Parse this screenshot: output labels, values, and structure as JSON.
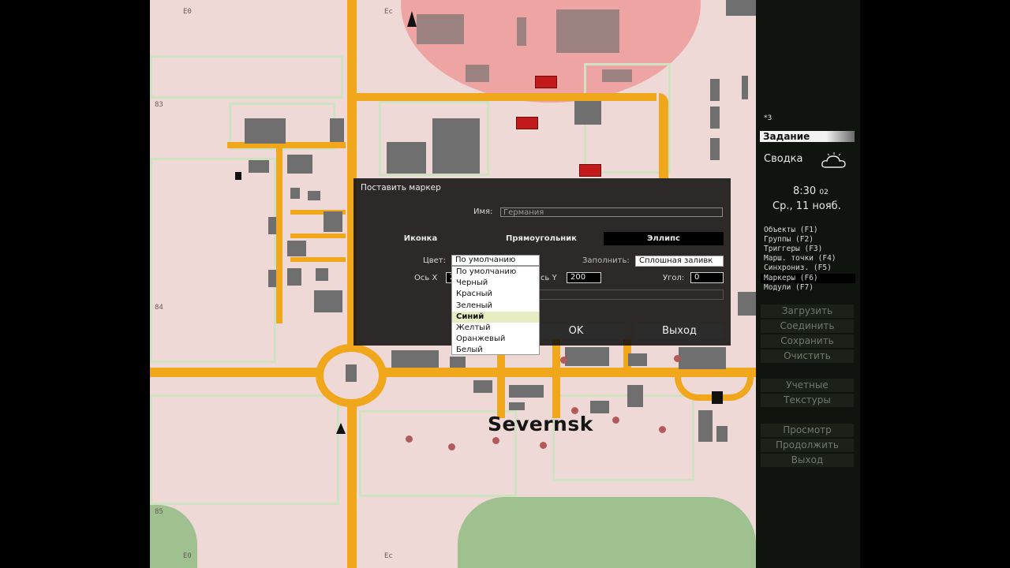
{
  "map": {
    "town": "Severnsk",
    "grid_labels": {
      "top_left": "E0",
      "top_mid": "Ec",
      "row_83": "83",
      "row_84": "84",
      "row_85": "85",
      "bottom_left": "E0",
      "bottom_mid": "Ec"
    },
    "colors": {
      "ground": "#efd9d6",
      "road": "#f0a71c",
      "forest": "#9fc08f",
      "building": "#6f6f6f",
      "danger_zone": "#ec7878"
    }
  },
  "right_panel": {
    "top_marker": "*3",
    "header": "Задание",
    "briefing": "Сводка",
    "weather_icon": "cloud-icon",
    "time": "8:30",
    "time_seconds": "02",
    "date": "Ср., 11 нояб.",
    "menu": [
      {
        "label": "Объекты (F1)",
        "selected": false
      },
      {
        "label": "Группы (F2)",
        "selected": false
      },
      {
        "label": "Триггеры (F3)",
        "selected": false
      },
      {
        "label": "Марш. точки (F4)",
        "selected": false
      },
      {
        "label": "Синхрониз. (F5)",
        "selected": false
      },
      {
        "label": "Маркеры (F6)",
        "selected": true
      },
      {
        "label": "Модули (F7)",
        "selected": false
      }
    ],
    "buttons_group1": [
      "Загрузить",
      "Соединить",
      "Сохранить",
      "Очистить"
    ],
    "buttons_group2": [
      "Учетные",
      "Текстуры"
    ],
    "buttons_group3": [
      "Просмотр",
      "Продолжить",
      "Выход"
    ]
  },
  "dialog": {
    "title": "Поставить маркер",
    "name_label": "Имя:",
    "name_value": "Германия",
    "shapes": {
      "icon": "Иконка",
      "rectangle": "Прямоугольник",
      "ellipse": "Эллипс",
      "selected": "ellipse"
    },
    "color_label": "Цвет:",
    "color_selected": "По умолчанию",
    "fill_label": "Заполнить:",
    "fill_value": "Сплошная заливк",
    "axis_x_label": "Ось X",
    "axis_x_value": "2",
    "axis_y_label": "сь Y",
    "axis_y_value": "200",
    "angle_label": "Угол:",
    "angle_value": "0",
    "ok_label": "OK",
    "exit_label": "Выход",
    "color_options": [
      {
        "label": "По умолчанию",
        "selected": false
      },
      {
        "label": "Черный",
        "selected": false
      },
      {
        "label": "Красный",
        "selected": false
      },
      {
        "label": "Зеленый",
        "selected": false
      },
      {
        "label": "Синий",
        "selected": true
      },
      {
        "label": "Желтый",
        "selected": false
      },
      {
        "label": "Оранжевый",
        "selected": false
      },
      {
        "label": "Белый",
        "selected": false
      }
    ]
  }
}
